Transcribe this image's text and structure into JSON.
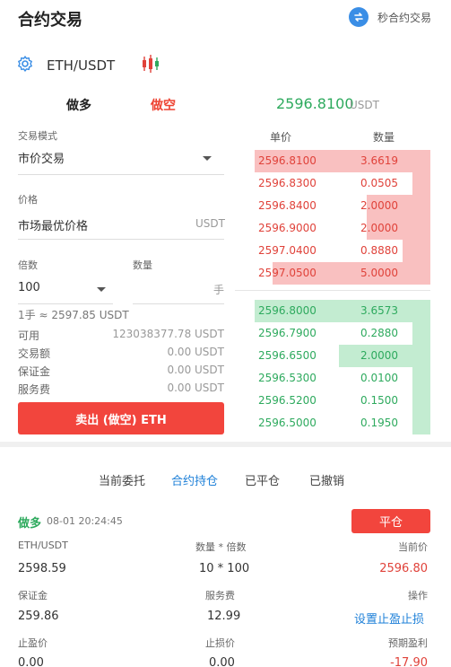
{
  "header": {
    "title": "合约交易",
    "second_contract_label": "秒合约交易",
    "accent": "#3a8ee6"
  },
  "pair": {
    "name": "ETH/USDT",
    "settings_icon": "gear-icon",
    "chart_icon": "candlestick-icon"
  },
  "tabs": {
    "long": "做多",
    "short": "做空"
  },
  "ticker": {
    "price": "2596.8100",
    "unit": "USDT"
  },
  "form": {
    "mode_label": "交易模式",
    "mode_value": "市价交易",
    "price_label": "价格",
    "price_value": "市场最优价格",
    "price_unit": "USDT",
    "leverage_label": "倍数",
    "leverage_value": "100",
    "qty_label": "数量",
    "qty_unit": "手",
    "lot_note": "1手 ≈ 2597.85 USDT",
    "available_label": "可用",
    "available_value": "123038377.78 USDT",
    "amount_label": "交易额",
    "amount_value": "0.00 USDT",
    "margin_label": "保证金",
    "margin_value": "0.00 USDT",
    "fee_label": "服务费",
    "fee_value": "0.00 USDT",
    "submit_label": "卖出 (做空) ETH"
  },
  "orderbook": {
    "price_header": "单价",
    "qty_header": "数量",
    "asks": [
      {
        "price": "2596.8100",
        "qty": "3.6619",
        "depth": 1.0
      },
      {
        "price": "2596.8300",
        "qty": "0.0505",
        "depth": 0.1
      },
      {
        "price": "2596.8400",
        "qty": "2.0000",
        "depth": 0.36
      },
      {
        "price": "2596.9000",
        "qty": "2.0000",
        "depth": 0.36
      },
      {
        "price": "2597.0400",
        "qty": "0.8880",
        "depth": 0.16
      },
      {
        "price": "2597.0500",
        "qty": "5.0000",
        "depth": 0.9
      }
    ],
    "bids": [
      {
        "price": "2596.8000",
        "qty": "3.6573",
        "depth": 1.0
      },
      {
        "price": "2596.7900",
        "qty": "0.2880",
        "depth": 0.1
      },
      {
        "price": "2596.6500",
        "qty": "2.0000",
        "depth": 0.52
      },
      {
        "price": "2596.5300",
        "qty": "0.0100",
        "depth": 0.1
      },
      {
        "price": "2596.5200",
        "qty": "0.1500",
        "depth": 0.1
      },
      {
        "price": "2596.5000",
        "qty": "0.1950",
        "depth": 0.1
      }
    ]
  },
  "lower_tabs": [
    "当前委托",
    "合约持仓",
    "已平仓",
    "已撤销"
  ],
  "position": {
    "direction": "做多",
    "time": "08-01 20:24:45",
    "close_label": "平仓",
    "pair_label": "ETH/USDT",
    "qty_lev_label": "数量 * 倍数",
    "current_price_label": "当前价",
    "open_price": "2598.59",
    "qty_lev_value": "10 * 100",
    "current_price": "2596.80",
    "margin_label": "保证金",
    "fee_label": "服务费",
    "action_label": "操作",
    "margin_value": "259.86",
    "fee_value": "12.99",
    "action_link": "设置止盈止损",
    "tp_label": "止盈价",
    "sl_label": "止损价",
    "pnl_label": "预期盈利",
    "tp_value": "0.00",
    "sl_value": "0.00",
    "pnl_value": "-17.90"
  }
}
